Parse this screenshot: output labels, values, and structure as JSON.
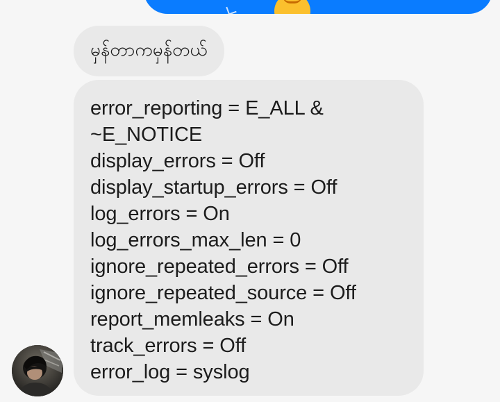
{
  "outgoing_message": {
    "emoji_icon": "smiling-face-emoji",
    "color": "#0a7cff"
  },
  "incoming_messages": [
    {
      "text": "မှန်တာကမှန်တယ်"
    },
    {
      "lines": [
        "error_reporting  =  E_ALL &",
        "~E_NOTICE",
        "display_errors = Off",
        "display_startup_errors = Off",
        "log_errors = On",
        "log_errors_max_len = 0",
        "ignore_repeated_errors = Off",
        "ignore_repeated_source = Off",
        "report_memleaks = On",
        "track_errors = Off",
        "error_log = syslog"
      ]
    }
  ],
  "sender": {
    "avatar_icon": "profile-photo"
  },
  "colors": {
    "background": "#f6f6f6",
    "incoming_bubble": "#e9e9e9",
    "outgoing_bubble": "#0a7cff",
    "text": "#1c1c1c"
  }
}
